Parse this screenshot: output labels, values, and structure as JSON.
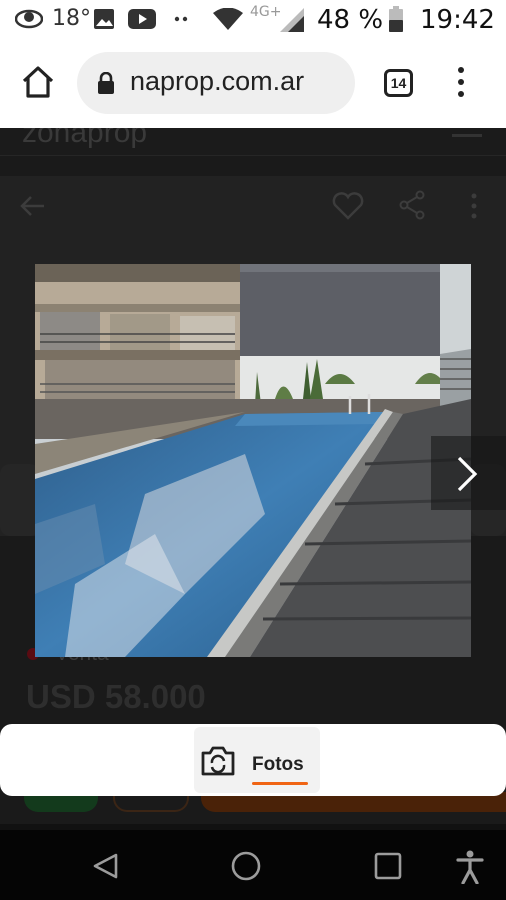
{
  "status_bar": {
    "temperature": "18°",
    "network": "4G+",
    "battery": "48 %",
    "time": "19:42",
    "icons": [
      "eye-icon",
      "image-icon",
      "youtube-icon",
      "more-dots-icon",
      "wifi-icon",
      "signal-icon",
      "battery-icon"
    ]
  },
  "browser": {
    "url": "naprop.com.ar",
    "tab_count": "14",
    "icons": [
      "home-icon",
      "lock-icon",
      "tabs-icon",
      "menu-icon"
    ]
  },
  "page": {
    "logo": "zonaprop",
    "listing_type": "Venta",
    "price": "USD 58.000",
    "icons": [
      "back-arrow-icon",
      "heart-icon",
      "share-icon",
      "more-vert-icon"
    ]
  },
  "gallery": {
    "next_icon": "chevron-right-icon"
  },
  "photos_bar": {
    "tab_label": "Fotos",
    "tab_icon": "camera-icon",
    "accent_color": "#f06414"
  },
  "nav_bar": {
    "icons": [
      "back-triangle-icon",
      "home-circle-icon",
      "recents-square-icon",
      "accessibility-icon"
    ]
  }
}
